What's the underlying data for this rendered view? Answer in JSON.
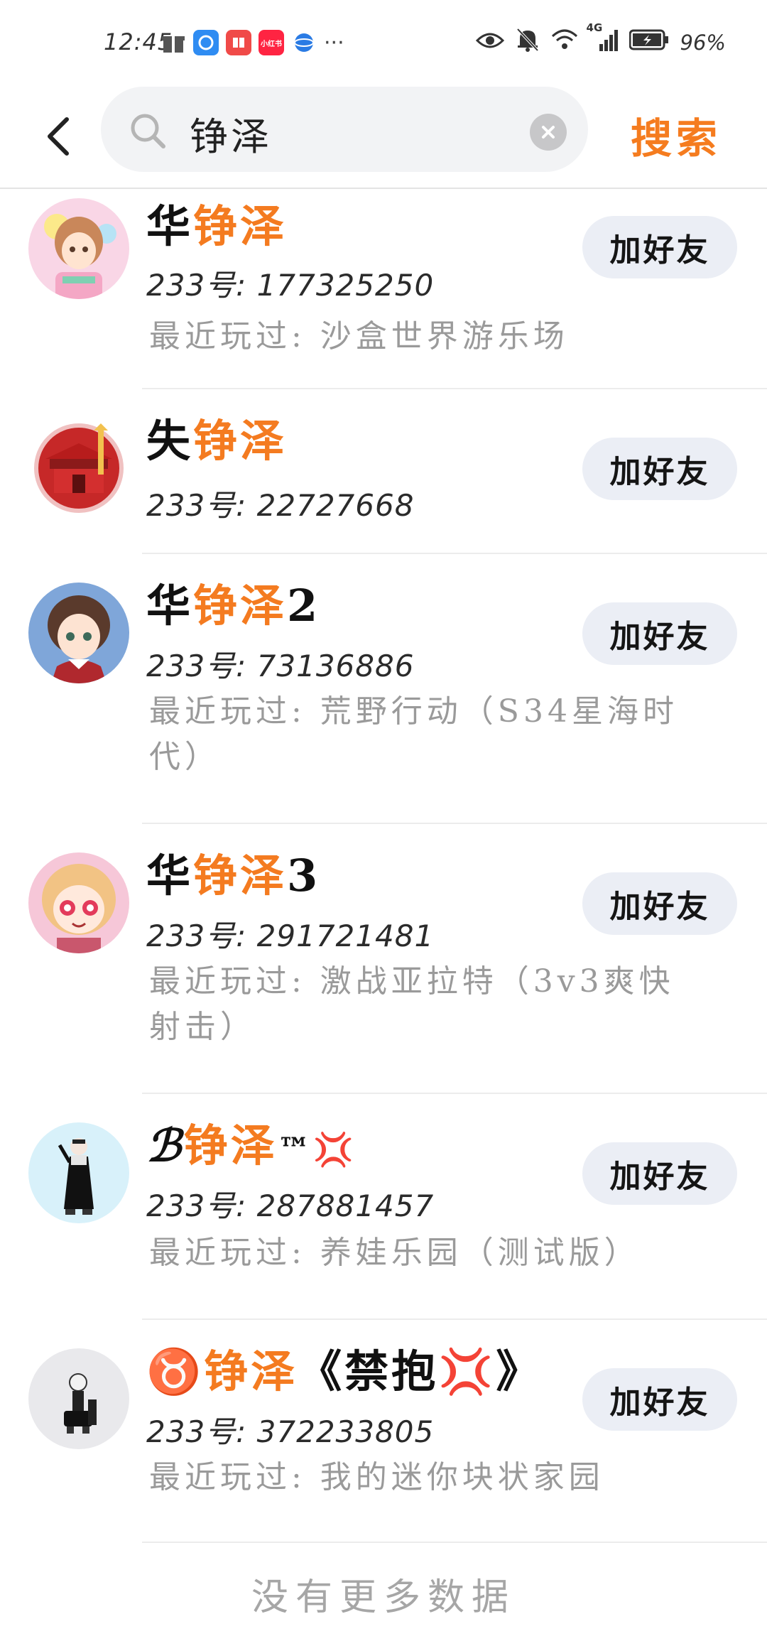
{
  "status_bar": {
    "time": "12:45",
    "battery": "96%",
    "network": "4G",
    "more": "···",
    "app_badge": "小红书"
  },
  "search": {
    "query": "铮泽",
    "action_label": "搜索"
  },
  "colors": {
    "accent": "#f47b20",
    "button_bg": "#ebeef5",
    "muted_text": "#9a9a9a"
  },
  "results": [
    {
      "name_prefix": "华",
      "name_highlight": "铮泽",
      "name_suffix": "",
      "uid": "233号: 177325250",
      "recent": "最近玩过: 沙盒世界游乐场",
      "button": "加好友"
    },
    {
      "name_prefix": "失",
      "name_highlight": "铮泽",
      "name_suffix": "",
      "uid": "233号: 22727668",
      "recent": "",
      "button": "加好友"
    },
    {
      "name_prefix": "华",
      "name_highlight": "铮泽",
      "name_suffix": "2",
      "uid": "233号: 73136886",
      "recent": "最近玩过: 荒野行动（S34星海时代）",
      "button": "加好友"
    },
    {
      "name_prefix": "华",
      "name_highlight": "铮泽",
      "name_suffix": "3",
      "uid": "233号: 291721481",
      "recent": "最近玩过: 激战亚拉特（3v3爽快射击）",
      "button": "加好友"
    },
    {
      "name_prefix": "ℬ",
      "name_highlight": "铮泽",
      "name_suffix": "™💢",
      "uid": "233号: 287881457",
      "recent": "最近玩过: 养娃乐园（测试版）",
      "button": "加好友"
    },
    {
      "name_prefix": "♉",
      "name_highlight": "铮泽",
      "name_suffix": "《禁抱💢》",
      "uid": "233号: 372233805",
      "recent": "最近玩过: 我的迷你块状家园",
      "button": "加好友"
    }
  ],
  "footer": "没有更多数据"
}
